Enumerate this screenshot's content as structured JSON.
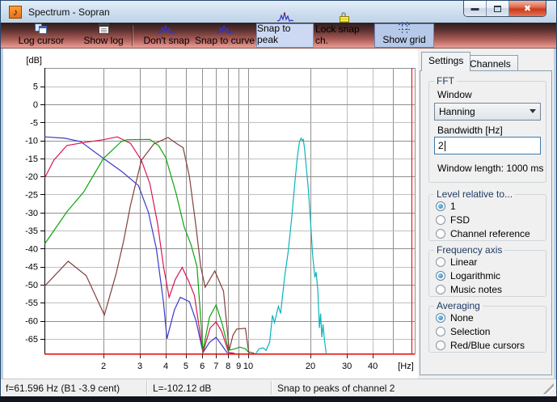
{
  "window": {
    "title": "Spectrum - Sopran"
  },
  "toolbar": {
    "buttons": [
      {
        "label": "Log cursor",
        "icon": "copy-log-icon",
        "active": false
      },
      {
        "label": "Show log",
        "icon": "notepad-icon",
        "active": false
      },
      {
        "label": "Don't snap",
        "icon": "spectrum-icon",
        "active": false
      },
      {
        "label": "Snap to curve",
        "icon": "spectrum-icon",
        "active": false
      },
      {
        "label": "Snap to peak",
        "icon": "spectrum-icon",
        "active": true
      },
      {
        "label": "Lock snap ch.",
        "icon": "padlock-icon",
        "active": false
      },
      {
        "label": "Show grid",
        "icon": "grid-icon",
        "active": true
      }
    ]
  },
  "panel": {
    "tabs": [
      {
        "label": "Settings",
        "active": true
      },
      {
        "label": "Channels",
        "active": false
      }
    ],
    "fft": {
      "legend": "FFT",
      "window_label": "Window",
      "window_value": "Hanning",
      "bandwidth_label": "Bandwidth [Hz]",
      "bandwidth_value": "2",
      "window_length": "Window length: 1000 ms"
    },
    "groups": [
      {
        "legend": "Level relative to...",
        "options": [
          {
            "label": "1",
            "selected": true
          },
          {
            "label": "FSD",
            "selected": false
          },
          {
            "label": "Channel reference",
            "selected": false
          }
        ]
      },
      {
        "legend": "Frequency axis",
        "options": [
          {
            "label": "Linear",
            "selected": false
          },
          {
            "label": "Logarithmic",
            "selected": true
          },
          {
            "label": "Music notes",
            "selected": false
          }
        ]
      },
      {
        "legend": "Averaging",
        "options": [
          {
            "label": "None",
            "selected": true
          },
          {
            "label": "Selection",
            "selected": false
          },
          {
            "label": "Red/Blue cursors",
            "selected": false
          }
        ]
      }
    ]
  },
  "status_bar": {
    "fields": [
      "f=61.596 Hz (B1 -3.9 cent)",
      "L=-102.12 dB",
      "Snap to peaks of channel 2"
    ]
  },
  "chart_data": {
    "type": "line",
    "title": "",
    "xlabel": "[Hz]",
    "ylabel": "[dB]",
    "x_scale": "log",
    "xlim": [
      1.037,
      63.8
    ],
    "ylim": [
      -69.3,
      10.1
    ],
    "x_ticks": [
      2,
      3,
      4,
      5,
      6,
      7,
      8,
      9,
      10,
      20,
      30,
      40
    ],
    "x_grid_extra": [
      50
    ],
    "y_ticks": [
      5,
      0,
      -5,
      -10,
      -15,
      -20,
      -25,
      -30,
      -35,
      -40,
      -45,
      -50,
      -55,
      -60,
      -65
    ],
    "grid": true,
    "legend_position": "none",
    "cursor": {
      "f_hz": 61.596,
      "level_db": -102.12,
      "color": "#e80000"
    },
    "series": [
      {
        "name": "channel-blue",
        "color": "#3a3acc",
        "points": [
          [
            1.04,
            -9
          ],
          [
            1.3,
            -9.4
          ],
          [
            1.55,
            -10.3
          ],
          [
            2.0,
            -15
          ],
          [
            2.45,
            -18.6
          ],
          [
            2.95,
            -22.5
          ],
          [
            3.3,
            -30
          ],
          [
            3.6,
            -40
          ],
          [
            3.9,
            -55
          ],
          [
            4.05,
            -65
          ],
          [
            4.4,
            -57
          ],
          [
            4.7,
            -53.5
          ],
          [
            5.2,
            -54.7
          ],
          [
            5.6,
            -60
          ],
          [
            6.05,
            -68.8
          ],
          [
            6.5,
            -66
          ],
          [
            7.0,
            -64.6
          ],
          [
            7.4,
            -66.5
          ],
          [
            7.9,
            -68.8
          ],
          [
            8.5,
            -69
          ]
        ]
      },
      {
        "name": "channel-red",
        "color": "#da1550",
        "points": [
          [
            1.04,
            -20.4
          ],
          [
            1.15,
            -15.5
          ],
          [
            1.33,
            -11.4
          ],
          [
            1.6,
            -10.6
          ],
          [
            2.0,
            -9.8
          ],
          [
            2.33,
            -9.0
          ],
          [
            2.7,
            -10.8
          ],
          [
            3.05,
            -15.5
          ],
          [
            3.35,
            -22
          ],
          [
            3.65,
            -33
          ],
          [
            3.9,
            -45
          ],
          [
            4.15,
            -53.5
          ],
          [
            4.45,
            -48.5
          ],
          [
            4.8,
            -45.2
          ],
          [
            5.2,
            -49.5
          ],
          [
            5.5,
            -53
          ],
          [
            6.05,
            -68.8
          ],
          [
            6.55,
            -62
          ],
          [
            7.0,
            -60.3
          ],
          [
            7.45,
            -63
          ],
          [
            8.05,
            -68.8
          ],
          [
            8.6,
            -69
          ]
        ]
      },
      {
        "name": "channel-green",
        "color": "#0aa50a",
        "points": [
          [
            1.04,
            -38.7
          ],
          [
            1.33,
            -29.8
          ],
          [
            1.6,
            -24.4
          ],
          [
            2.0,
            -15
          ],
          [
            2.44,
            -10.3
          ],
          [
            2.6,
            -9.8
          ],
          [
            3.35,
            -9.7
          ],
          [
            3.7,
            -11.5
          ],
          [
            4.0,
            -14.8
          ],
          [
            4.5,
            -25
          ],
          [
            4.9,
            -33.9
          ],
          [
            5.3,
            -39
          ],
          [
            5.66,
            -45
          ],
          [
            6.05,
            -68.3
          ],
          [
            6.5,
            -59
          ],
          [
            7.0,
            -55.6
          ],
          [
            7.5,
            -61
          ],
          [
            8.05,
            -68.2
          ],
          [
            8.6,
            -67.8
          ],
          [
            9.1,
            -67.3
          ],
          [
            9.7,
            -67.8
          ],
          [
            10.15,
            -69
          ]
        ]
      },
      {
        "name": "channel-darkred",
        "color": "#82403e",
        "points": [
          [
            1.04,
            -50.4
          ],
          [
            1.35,
            -43.5
          ],
          [
            1.65,
            -47.5
          ],
          [
            2.02,
            -58.4
          ],
          [
            2.3,
            -47
          ],
          [
            2.5,
            -38
          ],
          [
            2.7,
            -28
          ],
          [
            3.05,
            -15.5
          ],
          [
            3.5,
            -11
          ],
          [
            4.1,
            -9.2
          ],
          [
            4.55,
            -11
          ],
          [
            4.85,
            -12
          ],
          [
            5.2,
            -20
          ],
          [
            5.6,
            -34
          ],
          [
            5.9,
            -45
          ],
          [
            6.2,
            -50.7
          ],
          [
            6.9,
            -46.2
          ],
          [
            7.6,
            -51.8
          ],
          [
            8.1,
            -68.2
          ],
          [
            8.45,
            -64
          ],
          [
            8.8,
            -62.3
          ],
          [
            9.7,
            -62.1
          ],
          [
            10.05,
            -68.6
          ],
          [
            10.7,
            -69
          ]
        ]
      },
      {
        "name": "channel-cyan",
        "color": "#0ab4bc",
        "points": [
          [
            10.9,
            -69
          ],
          [
            11.3,
            -67.8
          ],
          [
            11.8,
            -67.5
          ],
          [
            12.2,
            -68.2
          ],
          [
            12.7,
            -66
          ],
          [
            13.1,
            -58.5
          ],
          [
            13.4,
            -60.5
          ],
          [
            14.0,
            -56
          ],
          [
            14.35,
            -58
          ],
          [
            15.0,
            -48
          ],
          [
            15.6,
            -41
          ],
          [
            16.2,
            -32
          ],
          [
            16.8,
            -22
          ],
          [
            17.3,
            -14.5
          ],
          [
            17.7,
            -10.4
          ],
          [
            18.0,
            -9.4
          ],
          [
            18.25,
            -10
          ],
          [
            18.45,
            -9.7
          ],
          [
            18.7,
            -12
          ],
          [
            19.0,
            -16
          ],
          [
            19.5,
            -23
          ],
          [
            20.0,
            -32
          ],
          [
            20.5,
            -42
          ],
          [
            21.0,
            -48
          ],
          [
            21.3,
            -46.5
          ],
          [
            21.7,
            -51.3
          ],
          [
            22.1,
            -62
          ],
          [
            22.4,
            -58
          ],
          [
            22.7,
            -64.6
          ],
          [
            23.0,
            -61
          ],
          [
            23.35,
            -65
          ],
          [
            23.8,
            -69
          ]
        ]
      }
    ]
  }
}
